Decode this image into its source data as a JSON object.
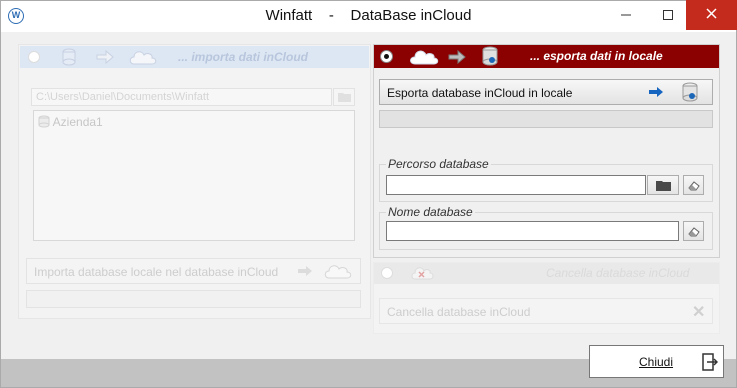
{
  "window": {
    "title": "Winfatt    -    DataBase inCloud",
    "min_icon": "minimize-icon",
    "max_icon": "maximize-icon",
    "close_icon": "close-icon"
  },
  "import_section": {
    "header_label": "... importa dati inCloud",
    "path_value": "C:\\Users\\Daniel\\Documents\\Winfatt",
    "list_items": [
      "Azienda1"
    ],
    "import_button_label": "Importa database locale nel database inCloud",
    "enabled": false,
    "header_color": "#dde6f3"
  },
  "export_section": {
    "header_label": "... esporta dati in locale",
    "selected": true,
    "export_button_label": "Esporta database inCloud in locale",
    "percorso": {
      "label": "Percorso database",
      "value": ""
    },
    "nome": {
      "label": "Nome database",
      "value": ""
    },
    "header_color": "#8b0000"
  },
  "delete_section": {
    "header_label": "Cancella database inCloud",
    "delete_button_label": "Cancella database inCloud",
    "enabled": false
  },
  "footer": {
    "close_button_label": "Chiudi"
  },
  "colors": {
    "accent_blue": "#1565c0",
    "close_red": "#c42b1c"
  }
}
